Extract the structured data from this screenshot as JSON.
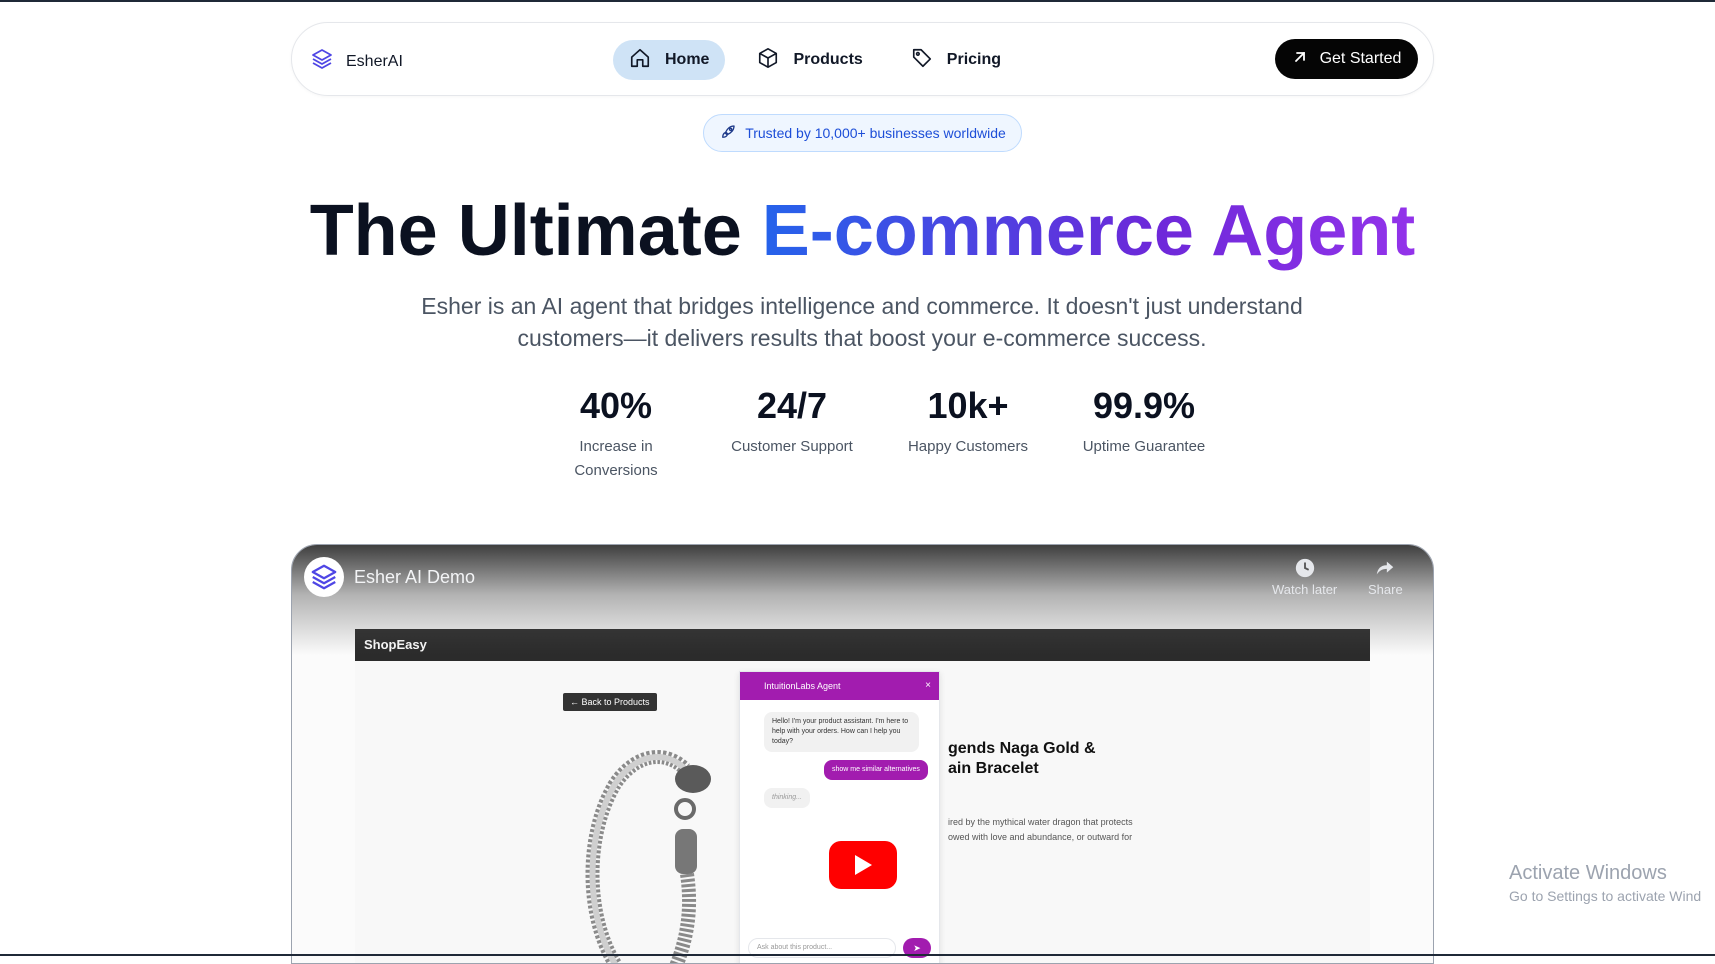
{
  "brand": {
    "name": "EsherAI",
    "icon": "layers-icon"
  },
  "nav": {
    "items": [
      {
        "label": "Home",
        "icon": "home-icon",
        "active": true
      },
      {
        "label": "Products",
        "icon": "box-icon",
        "active": false
      },
      {
        "label": "Pricing",
        "icon": "tag-icon",
        "active": false
      }
    ],
    "cta_label": "Get Started",
    "cta_icon": "arrow-up-right-icon"
  },
  "trust_badge": {
    "icon": "rocket-icon",
    "text": "Trusted by 10,000+ businesses worldwide"
  },
  "hero": {
    "title_plain": "The Ultimate ",
    "title_highlight": "E-commerce Agent",
    "subtitle": "Esher is an AI agent that bridges intelligence and commerce. It doesn't just understand customers—it delivers results that boost your e-commerce success."
  },
  "stats": [
    {
      "value": "40%",
      "label": "Increase in Conversions"
    },
    {
      "value": "24/7",
      "label": "Customer Support"
    },
    {
      "value": "10k+",
      "label": "Happy Customers"
    },
    {
      "value": "99.9%",
      "label": "Uptime Guarantee"
    }
  ],
  "video": {
    "title": "Esher AI Demo",
    "watch_later": "Watch later",
    "share": "Share",
    "shop": {
      "name": "ShopEasy",
      "back": "← Back to Products",
      "product_title_line1": "gends Naga Gold &",
      "product_title_line2": "ain Bracelet",
      "desc_line1": "ired by the mythical water dragon that protects",
      "desc_line2": "owed with love and abundance, or outward for"
    },
    "chat": {
      "title": "IntuitionLabs Agent",
      "close": "×",
      "bot_message": "Hello! I'm your product assistant. I'm here to help with your orders. How can I help you today?",
      "user_message": "show me similar alternatives",
      "thinking": "thinking...",
      "input_placeholder": "Ask about this product..."
    }
  },
  "watermark": {
    "title": "Activate Windows",
    "sub": "Go to Settings to activate Wind"
  },
  "colors": {
    "accent_blue": "#2563eb",
    "accent_purple": "#9333ea",
    "cta_bg": "#050505",
    "active_nav": "#cfe3f6"
  }
}
